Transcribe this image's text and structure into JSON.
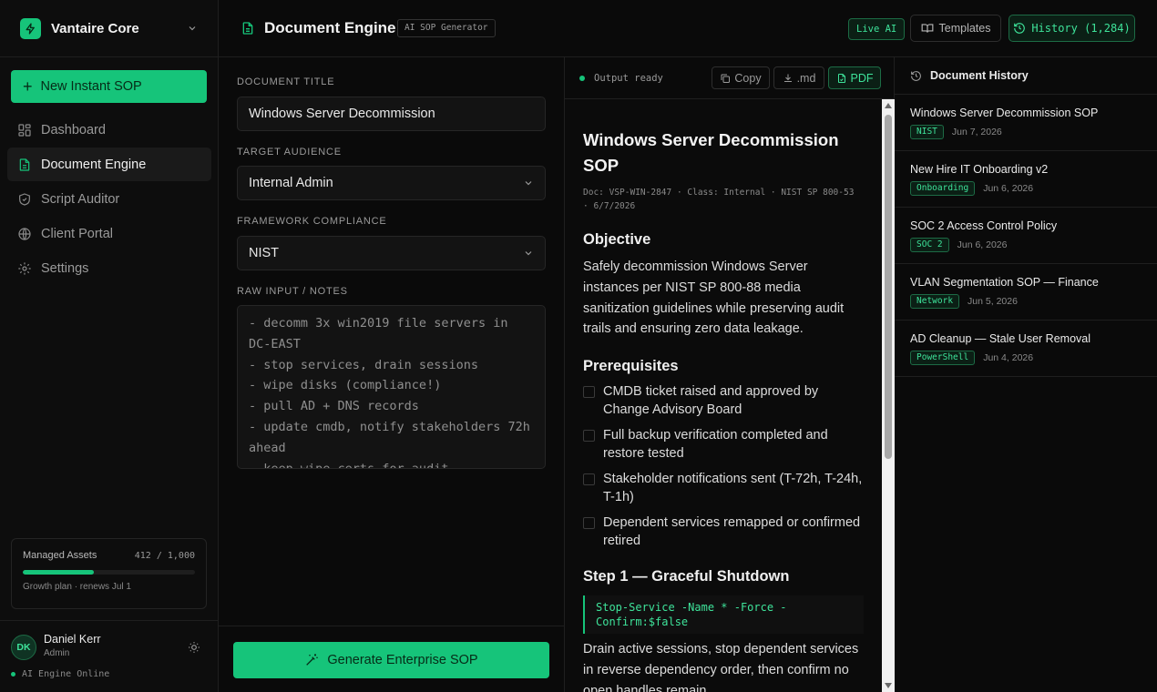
{
  "brand": {
    "name": "Vantaire Core"
  },
  "sidebar": {
    "new_button": "New Instant SOP",
    "items": [
      {
        "label": "Dashboard",
        "icon": "dashboard-icon"
      },
      {
        "label": "Document Engine",
        "icon": "document-icon",
        "active": true
      },
      {
        "label": "Script Auditor",
        "icon": "shield-icon"
      },
      {
        "label": "Client Portal",
        "icon": "globe-icon"
      },
      {
        "label": "Settings",
        "icon": "gear-icon"
      }
    ],
    "assets": {
      "label": "Managed Assets",
      "count": "412 / 1,000",
      "fraction": 0.412,
      "note": "Growth plan · renews Jul 1"
    },
    "user": {
      "initials": "DK",
      "name": "Daniel Kerr",
      "role": "Admin",
      "status": "AI Engine Online"
    }
  },
  "header": {
    "title": "Document Engine",
    "badge": "AI SOP Generator",
    "live": "Live AI",
    "templates": "Templates",
    "history": "History (1,284)"
  },
  "form": {
    "title_label": "DOCUMENT TITLE",
    "title_value": "Windows Server Decommission",
    "audience_label": "TARGET AUDIENCE",
    "audience_value": "Internal Admin",
    "framework_label": "FRAMEWORK COMPLIANCE",
    "framework_value": "NIST",
    "notes_label": "RAW INPUT / NOTES",
    "notes_value": "- decomm 3x win2019 file servers in DC-EAST\n- stop services, drain sessions\n- wipe disks (compliance!)\n- pull AD + DNS records\n- update cmdb, notify stakeholders 72h ahead\n- keep wipe certs for audit",
    "generate_button": "Generate Enterprise SOP"
  },
  "output": {
    "status": "Output ready",
    "copy": "Copy",
    "md": ".md",
    "pdf": "PDF",
    "doc": {
      "title": "Windows Server Decommission SOP",
      "meta": "Doc: VSP-WIN-2847 · Class: Internal · NIST SP 800-53 · 6/7/2026",
      "objective_heading": "Objective",
      "objective_text": "Safely decommission Windows Server instances per NIST SP 800-88 media sanitization guidelines while preserving audit trails and ensuring zero data leakage.",
      "prereq_heading": "Prerequisites",
      "prereqs": [
        "CMDB ticket raised and approved by Change Advisory Board",
        "Full backup verification completed and restore tested",
        "Stakeholder notifications sent (T-72h, T-24h, T-1h)",
        "Dependent services remapped or confirmed retired"
      ],
      "step1_heading": "Step 1 — Graceful Shutdown",
      "step1_code": "Stop-Service -Name * -Force -Confirm:$false",
      "step1_text": "Drain active sessions, stop dependent services in reverse dependency order, then confirm no open handles remain."
    }
  },
  "history": {
    "title": "Document History",
    "items": [
      {
        "name": "Windows Server Decommission SOP",
        "tag": "NIST",
        "date": "Jun 7, 2026"
      },
      {
        "name": "New Hire IT Onboarding v2",
        "tag": "Onboarding",
        "date": "Jun 6, 2026"
      },
      {
        "name": "SOC 2 Access Control Policy",
        "tag": "SOC 2",
        "date": "Jun 6, 2026"
      },
      {
        "name": "VLAN Segmentation SOP — Finance",
        "tag": "Network",
        "date": "Jun 5, 2026"
      },
      {
        "name": "AD Cleanup — Stale User Removal",
        "tag": "PowerShell",
        "date": "Jun 4, 2026"
      }
    ]
  },
  "colors": {
    "accent": "#16c47a",
    "accent_text": "#3ee39a",
    "background": "#0a0a0a"
  }
}
